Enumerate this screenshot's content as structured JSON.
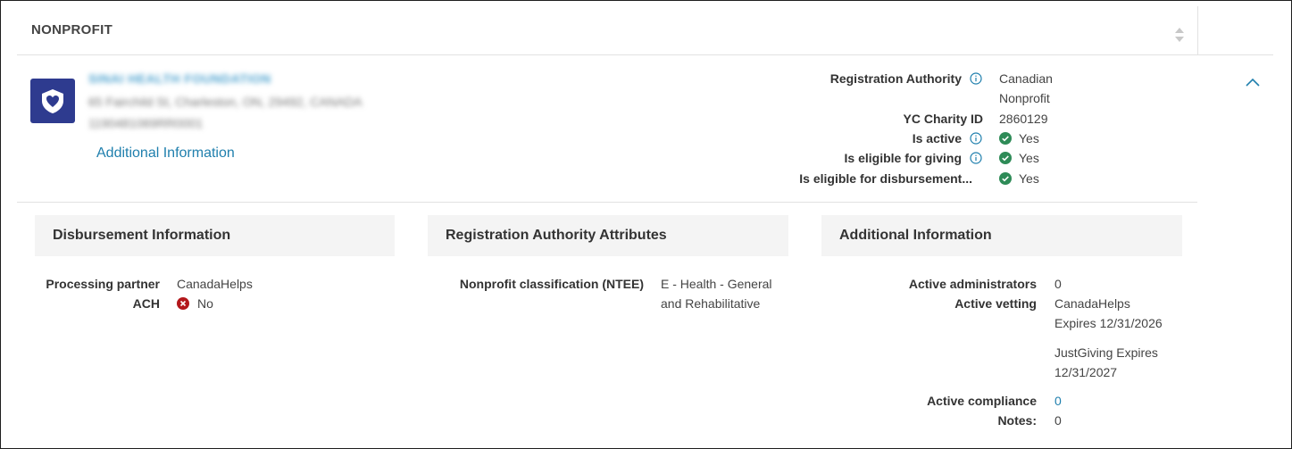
{
  "header": {
    "title": "NONPROFIT"
  },
  "org": {
    "name": "SINAI HEALTH FOUNDATION",
    "address": "65 Fairchild St, Charleston, ON, 29492, CANADA",
    "identifier": "1190481069RR0001",
    "additional_info_link": "Additional Information"
  },
  "summary": {
    "registration_authority_label": "Registration Authority",
    "registration_authority_value_1": "Canadian",
    "registration_authority_value_2": "Nonprofit",
    "charity_id_label": "YC Charity ID",
    "charity_id_value": "2860129",
    "is_active_label": "Is active",
    "is_active_value": "Yes",
    "eligible_giving_label": "Is eligible for giving",
    "eligible_giving_value": "Yes",
    "eligible_disbursement_label": "Is eligible for disbursement...",
    "eligible_disbursement_value": "Yes"
  },
  "disbursement": {
    "title": "Disbursement Information",
    "processing_partner_label": "Processing partner",
    "processing_partner_value": "CanadaHelps",
    "ach_label": "ACH",
    "ach_value": "No"
  },
  "registration_attributes": {
    "title": "Registration Authority Attributes",
    "ntee_label": "Nonprofit classification (NTEE)",
    "ntee_value_1": "E - Health - General",
    "ntee_value_2": "and Rehabilitative"
  },
  "additional": {
    "title": "Additional Information",
    "active_admins_label": "Active administrators",
    "active_admins_value": "0",
    "active_vetting_label": "Active vetting",
    "vetting_1_line1": "CanadaHelps",
    "vetting_1_line2": "Expires 12/31/2026",
    "vetting_2_line1": "JustGiving Expires",
    "vetting_2_line2": "12/31/2027",
    "active_compliance_label": "Active compliance",
    "active_compliance_value": "0",
    "notes_label": "Notes:",
    "notes_value": "0"
  },
  "colors": {
    "accent": "#1f7fad",
    "success": "#2e8b57",
    "error": "#b3181b",
    "logo_bg": "#2e3b8f"
  },
  "icons": [
    "sort-icon",
    "info-icon",
    "check-circle-icon",
    "x-circle-icon",
    "chevron-up-icon",
    "heart-shield-icon"
  ]
}
